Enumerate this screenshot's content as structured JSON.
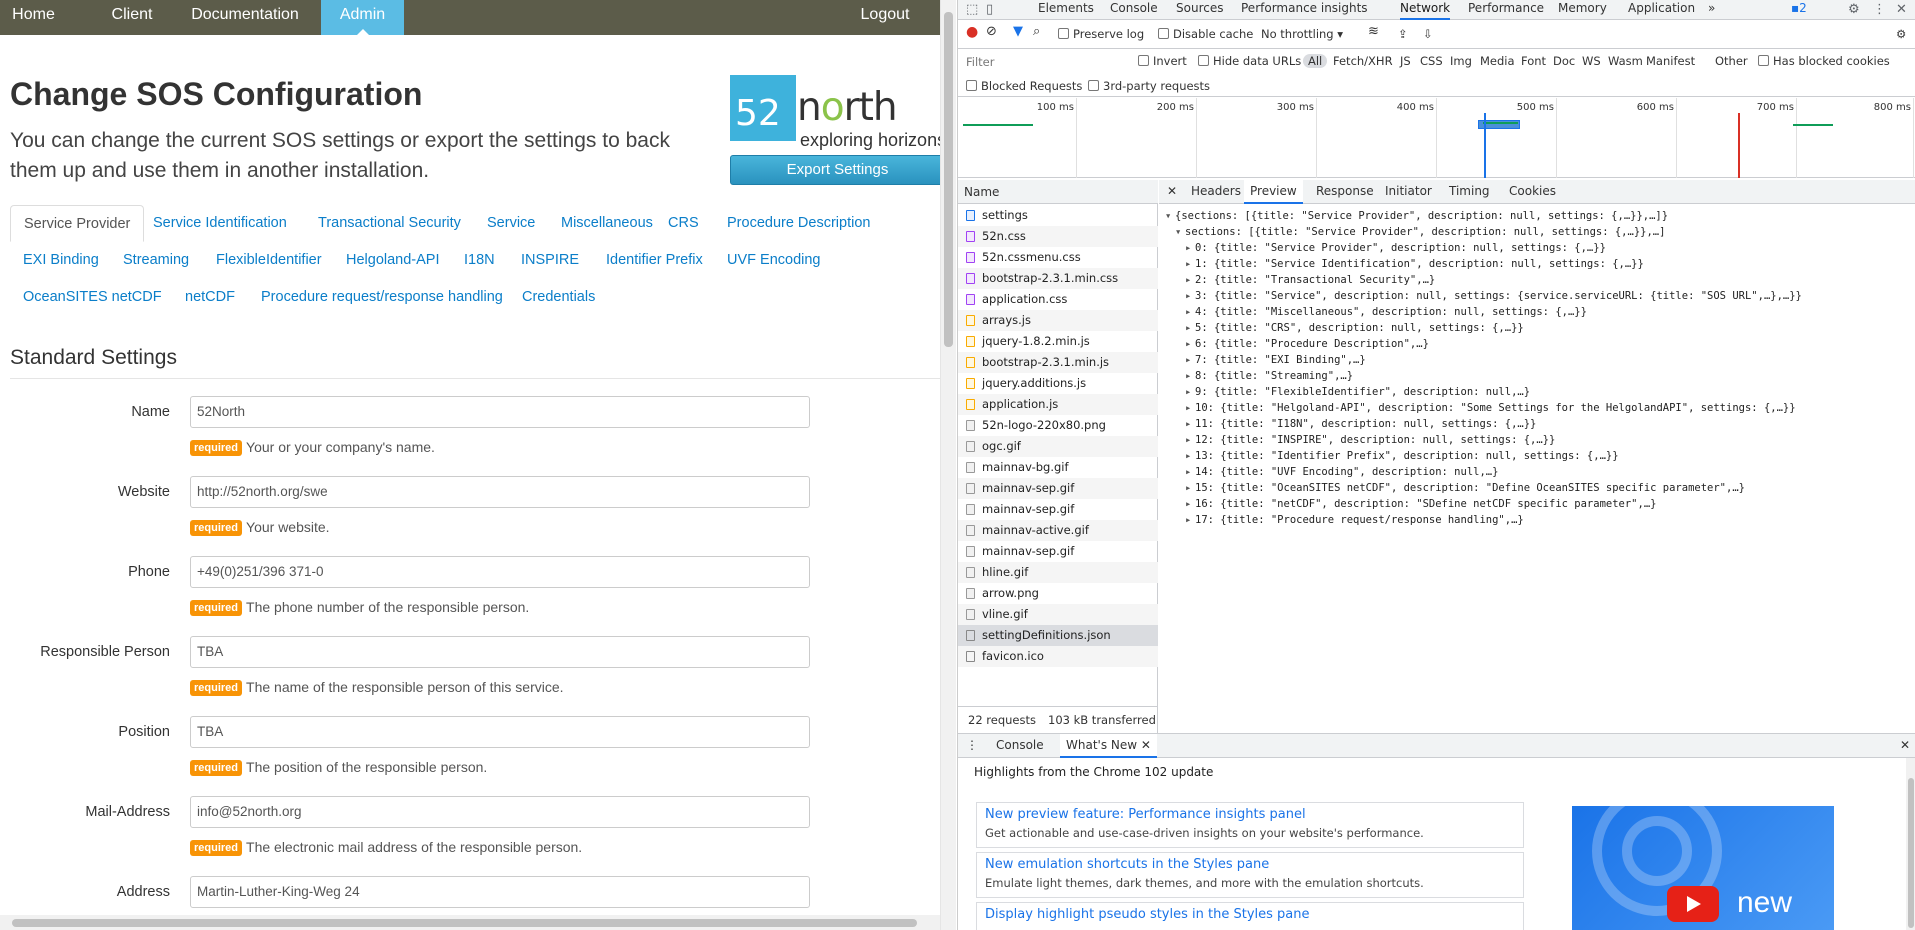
{
  "nav": {
    "items": [
      "Home",
      "Client",
      "Documentation",
      "Admin"
    ],
    "active": "Admin",
    "logout": "Logout"
  },
  "page": {
    "title": "Change SOS Configuration",
    "intro": "You can change the current SOS settings or export the settings to back them up and use them in another installation.",
    "export_label": "Export Settings",
    "logo": {
      "digits": "52",
      "word_n": "n",
      "word_o": "o",
      "word_rest": "rth",
      "tagline": "exploring horizons"
    }
  },
  "tabs": [
    "Service Provider",
    "Service Identification",
    "Transactional Security",
    "Service",
    "Miscellaneous",
    "CRS",
    "Procedure Description",
    "EXI Binding",
    "Streaming",
    "FlexibleIdentifier",
    "Helgoland-API",
    "I18N",
    "INSPIRE",
    "Identifier Prefix",
    "UVF Encoding",
    "OceanSITES netCDF",
    "netCDF",
    "Procedure request/response handling",
    "Credentials"
  ],
  "section_heading": "Standard Settings",
  "fields": [
    {
      "label": "Name",
      "value": "52North",
      "badge": "required",
      "help": "Your or your company's name."
    },
    {
      "label": "Website",
      "value": "http://52north.org/swe",
      "badge": "required",
      "help": "Your website."
    },
    {
      "label": "Phone",
      "value": "+49(0)251/396 371-0",
      "badge": "required",
      "help": "The phone number of the responsible person."
    },
    {
      "label": "Responsible Person",
      "value": "TBA",
      "badge": "required",
      "help": "The name of the responsible person of this service."
    },
    {
      "label": "Position",
      "value": "TBA",
      "badge": "required",
      "help": "The position of the responsible person."
    },
    {
      "label": "Mail-Address",
      "value": "info@52north.org",
      "badge": "required",
      "help": "The electronic mail address of the responsible person."
    },
    {
      "label": "Address",
      "value": "Martin-Luther-King-Weg 24"
    }
  ],
  "devtools": {
    "tabs": [
      "Elements",
      "Console",
      "Sources",
      "Performance insights",
      "Network",
      "Performance",
      "Memory",
      "Application"
    ],
    "active_tab": "Network",
    "more": "»",
    "issues_count": "2",
    "toolbar": {
      "preserve_log": "Preserve log",
      "disable_cache": "Disable cache",
      "throttling": "No throttling"
    },
    "filter": {
      "placeholder": "Filter",
      "invert": "Invert",
      "hide_data_urls": "Hide data URLs",
      "types": [
        "All",
        "Fetch/XHR",
        "JS",
        "CSS",
        "Img",
        "Media",
        "Font",
        "Doc",
        "WS",
        "Wasm",
        "Manifest",
        "Other"
      ],
      "has_blocked_cookies": "Has blocked cookies",
      "blocked_requests": "Blocked Requests",
      "third_party": "3rd-party requests"
    },
    "timeline_labels": [
      "100 ms",
      "200 ms",
      "300 ms",
      "400 ms",
      "500 ms",
      "600 ms",
      "700 ms",
      "800 ms"
    ],
    "requests_header": "Name",
    "requests": [
      {
        "name": "settings",
        "type": "doc"
      },
      {
        "name": "52n.css",
        "type": "css"
      },
      {
        "name": "52n.cssmenu.css",
        "type": "css"
      },
      {
        "name": "bootstrap-2.3.1.min.css",
        "type": "css"
      },
      {
        "name": "application.css",
        "type": "css"
      },
      {
        "name": "arrays.js",
        "type": "js"
      },
      {
        "name": "jquery-1.8.2.min.js",
        "type": "js"
      },
      {
        "name": "bootstrap-2.3.1.min.js",
        "type": "js"
      },
      {
        "name": "jquery.additions.js",
        "type": "js"
      },
      {
        "name": "application.js",
        "type": "js"
      },
      {
        "name": "52n-logo-220x80.png",
        "type": "img"
      },
      {
        "name": "ogc.gif",
        "type": "img"
      },
      {
        "name": "mainnav-bg.gif",
        "type": "img"
      },
      {
        "name": "mainnav-sep.gif",
        "type": "img"
      },
      {
        "name": "mainnav-sep.gif",
        "type": "img"
      },
      {
        "name": "mainnav-active.gif",
        "type": "img"
      },
      {
        "name": "mainnav-sep.gif",
        "type": "img"
      },
      {
        "name": "hline.gif",
        "type": "img"
      },
      {
        "name": "arrow.png",
        "type": "img"
      },
      {
        "name": "vline.gif",
        "type": "img"
      },
      {
        "name": "settingDefinitions.json",
        "type": "other"
      },
      {
        "name": "favicon.ico",
        "type": "other"
      }
    ],
    "status": {
      "requests": "22 requests",
      "transferred": "103 kB transferred"
    },
    "preview_tabs": [
      "Headers",
      "Preview",
      "Response",
      "Initiator",
      "Timing",
      "Cookies"
    ],
    "preview_active": "Preview",
    "json_lines": [
      "{sections: [{title: \"Service Provider\", description: null, settings: {,…}},…]}",
      "sections: [{title: \"Service Provider\", description: null, settings: {,…}},…]",
      "0: {title: \"Service Provider\", description: null, settings: {,…}}",
      "1: {title: \"Service Identification\", description: null, settings: {,…}}",
      "2: {title: \"Transactional Security\",…}",
      "3: {title: \"Service\", description: null, settings: {service.serviceURL: {title: \"SOS URL\",…},…}}",
      "4: {title: \"Miscellaneous\", description: null, settings: {,…}}",
      "5: {title: \"CRS\", description: null, settings: {,…}}",
      "6: {title: \"Procedure Description\",…}",
      "7: {title: \"EXI Binding\",…}",
      "8: {title: \"Streaming\",…}",
      "9: {title: \"FlexibleIdentifier\", description: null,…}",
      "10: {title: \"Helgoland-API\", description: \"Some Settings for the HelgolandAPI\", settings: {,…}}",
      "11: {title: \"I18N\", description: null, settings: {,…}}",
      "12: {title: \"INSPIRE\", description: null, settings: {,…}}",
      "13: {title: \"Identifier Prefix\", description: null, settings: {,…}}",
      "14: {title: \"UVF Encoding\", description: null,…}",
      "15: {title: \"OceanSITES netCDF\", description: \"Define OceanSITES specific parameter\",…}",
      "16: {title: \"netCDF\", description: \"SDefine netCDF specific parameter\",…}",
      "17: {title: \"Procedure request/response handling\",…}"
    ],
    "drawer": {
      "tabs": [
        "Console",
        "What's New"
      ],
      "active": "What's New",
      "heading": "Highlights from the Chrome 102 update",
      "items": [
        {
          "title": "New preview feature: Performance insights panel",
          "desc": "Get actionable and use-case-driven insights on your website's performance."
        },
        {
          "title": "New emulation shortcuts in the Styles pane",
          "desc": "Emulate light themes, dark themes, and more with the emulation shortcuts."
        },
        {
          "title": "Display highlight pseudo styles in the Styles pane",
          "desc": ""
        }
      ],
      "video_text": "new"
    }
  }
}
